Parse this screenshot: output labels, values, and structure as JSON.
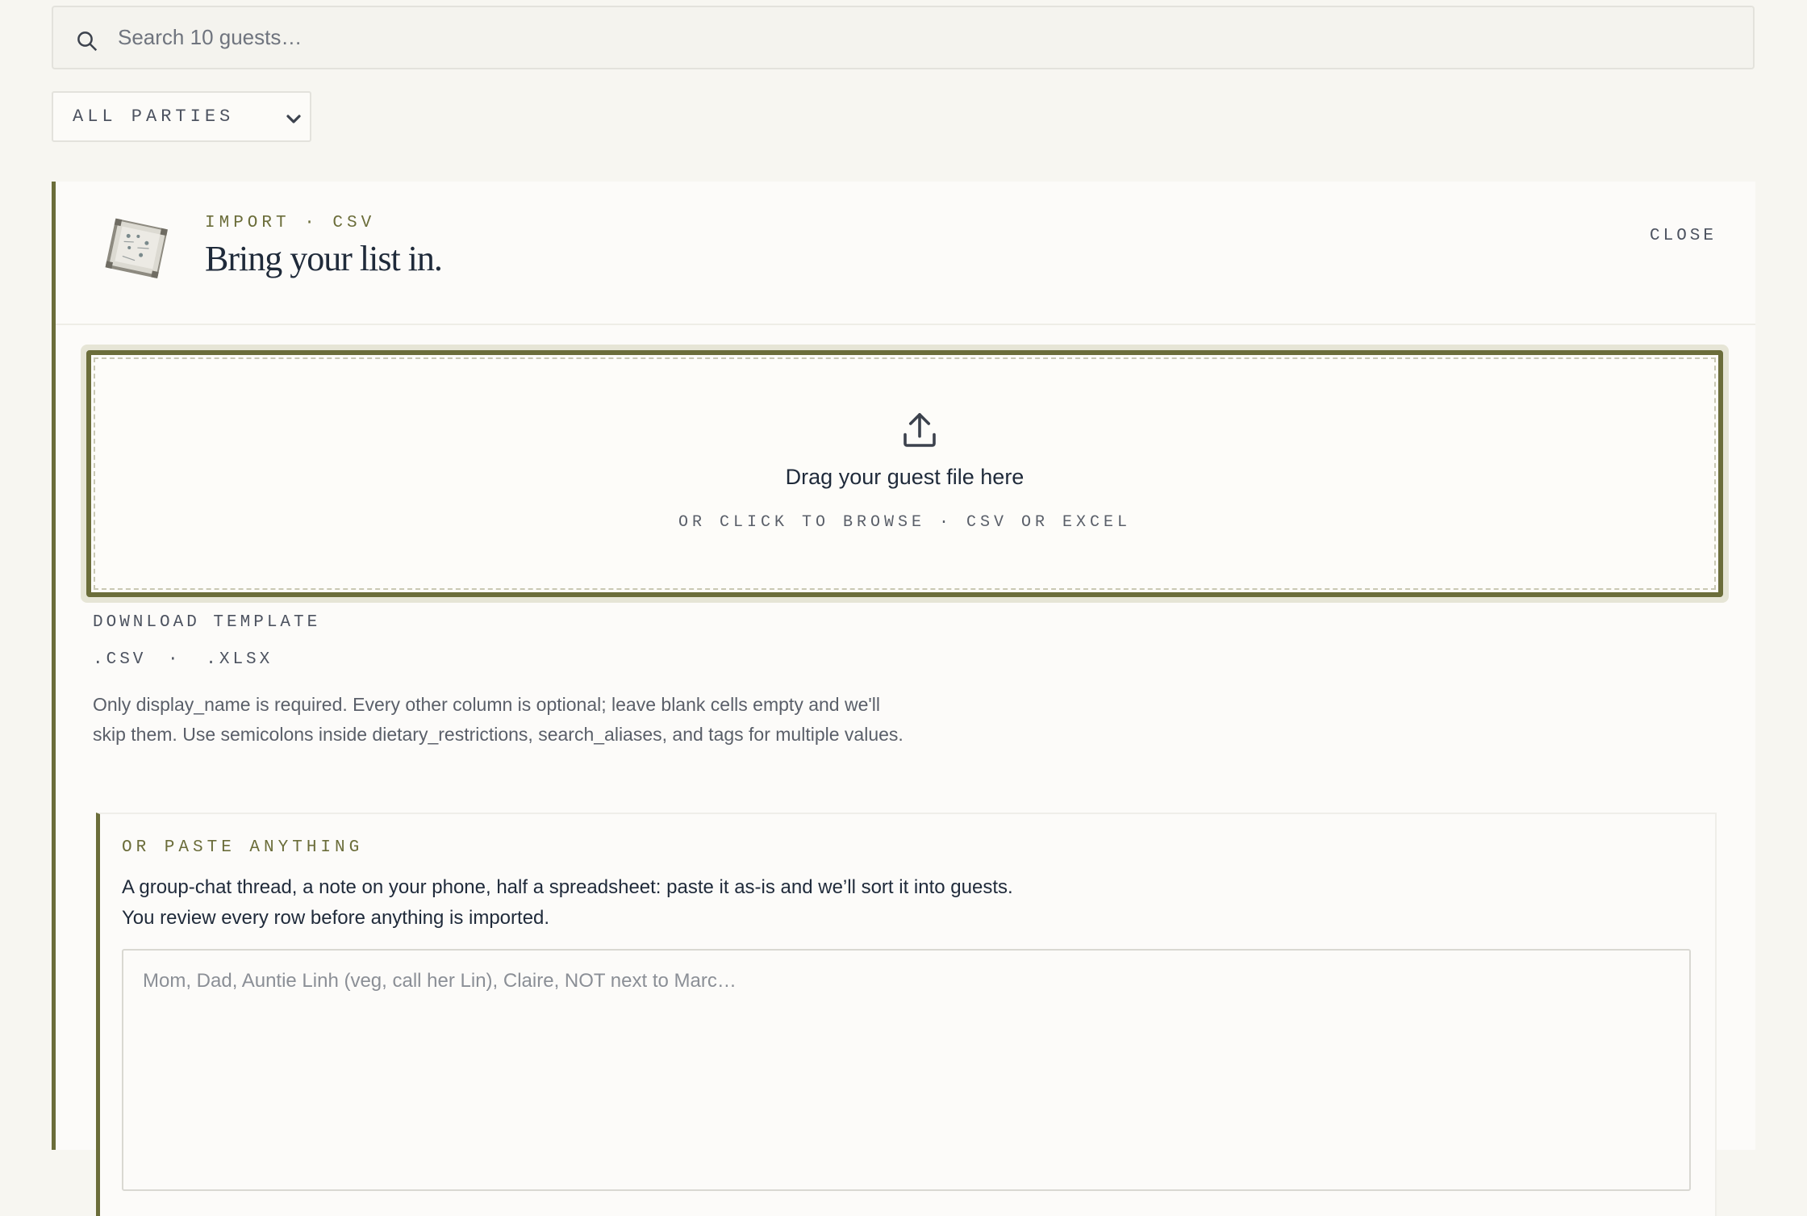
{
  "search": {
    "placeholder": "Search 10 guests…",
    "icon": "search-icon"
  },
  "filter": {
    "selected": "ALL PARTIES"
  },
  "import_panel": {
    "eyebrow": "IMPORT · CSV",
    "title": "Bring your list in.",
    "close_label": "CLOSE",
    "illustration": "seating-chart-illustration",
    "dropzone": {
      "icon": "upload-icon",
      "title": "Drag your guest file here",
      "subtitle": "OR CLICK TO BROWSE · CSV OR EXCEL"
    },
    "template": {
      "label": "DOWNLOAD TEMPLATE",
      "csv_link": ".CSV",
      "separator": "·",
      "xlsx_link": ".XLSX"
    },
    "help_text": "Only display_name is required. Every other column is optional; leave blank cells empty and we'll skip them. Use semicolons inside dietary_restrictions, search_aliases, and tags for multiple values.",
    "paste": {
      "eyebrow": "OR PASTE ANYTHING",
      "description": "A group-chat thread, a note on your phone, half a spreadsheet: paste it as-is and we’ll sort it into guests. You review every row before anything is imported.",
      "placeholder": "Mom, Dad, Auntie Linh (veg, call her Lin), Claire, NOT next to Marc…"
    }
  },
  "colors": {
    "accent": "#6b6d3a",
    "background": "#f7f6f1",
    "text": "#1f2a3a"
  }
}
